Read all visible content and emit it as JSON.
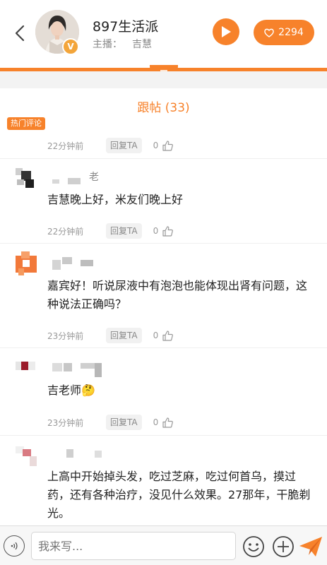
{
  "header": {
    "station_name": "897生活派",
    "host_label": "主播：",
    "host_name": "吉慧",
    "vip_mark": "V",
    "like_count": "2294"
  },
  "thread": {
    "title": "跟帖 (33)",
    "hot_tag": "热门评论"
  },
  "comments": [
    {
      "time": "22分钟前",
      "reply_label": "回复TA",
      "likes": "0",
      "text": ""
    },
    {
      "name_suffix": "老",
      "time": "22分钟前",
      "reply_label": "回复TA",
      "likes": "0",
      "text": "吉慧晚上好，米友们晚上好"
    },
    {
      "time": "23分钟前",
      "reply_label": "回复TA",
      "likes": "0",
      "text": "嘉宾好！听说尿液中有泡泡也能体现出肾有问题，这种说法正确吗？"
    },
    {
      "time": "23分钟前",
      "reply_label": "回复TA",
      "likes": "0",
      "text": "吉老师🤔"
    },
    {
      "text": "上高中开始掉头发，吃过芝麻，吃过何首乌，摸过药，还有各种治疗，没见什么效果。27那年，干脆剃光。"
    }
  ],
  "composer": {
    "placeholder": "我来写..."
  },
  "colors": {
    "accent": "#f7822b",
    "badge": "#f3a53a"
  },
  "icons": [
    "back-arrow-icon",
    "play-icon",
    "heart-icon",
    "handle-icon",
    "thumb-up-icon",
    "voice-icon",
    "emoji-icon",
    "plus-icon",
    "send-icon"
  ]
}
